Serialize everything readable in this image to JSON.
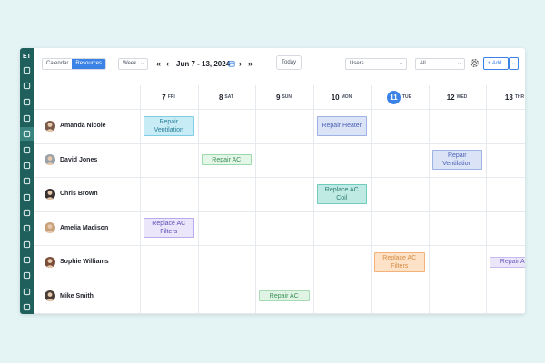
{
  "sidebar": {
    "logo": "ET",
    "icons": [
      "home-icon",
      "tool-icon",
      "plug-icon",
      "users-icon",
      "briefcase-icon",
      "user-icon",
      "folder-icon",
      "dollar-icon",
      "document-icon",
      "gem-icon",
      "team-icon",
      "wrench-icon",
      "chart-icon",
      "inbox-icon",
      "report-icon",
      "logout-icon"
    ]
  },
  "toolbar": {
    "views": [
      "Calendar",
      "Resources"
    ],
    "active_view": "Resources",
    "range_select": "Week",
    "date_range": "Jun 7 - 13, 2024",
    "today_label": "Today",
    "users_select": "Users",
    "filter_select": "All",
    "add_label": "+ Add"
  },
  "days": [
    {
      "num": "7",
      "name": "FRI",
      "today": false
    },
    {
      "num": "8",
      "name": "SAT",
      "today": false
    },
    {
      "num": "9",
      "name": "SUN",
      "today": false
    },
    {
      "num": "10",
      "name": "MON",
      "today": false
    },
    {
      "num": "11",
      "name": "TUE",
      "today": true
    },
    {
      "num": "12",
      "name": "WED",
      "today": false
    },
    {
      "num": "13",
      "name": "THR",
      "today": false
    }
  ],
  "people": [
    {
      "name": "Amanda Nicole"
    },
    {
      "name": "David Jones"
    },
    {
      "name": "Chris Brown"
    },
    {
      "name": "Amelia Madison"
    },
    {
      "name": "Sophie Williams"
    },
    {
      "name": "Mike Smith"
    }
  ],
  "events": [
    {
      "label": "Repair Ventilation",
      "person": 0,
      "day": 0,
      "color": "cyan"
    },
    {
      "label": "Repair Heater",
      "person": 0,
      "day": 3,
      "color": "blue"
    },
    {
      "label": "Repair AC",
      "person": 1,
      "day": 1,
      "color": "green"
    },
    {
      "label": "Repair Ventilation",
      "person": 1,
      "day": 5,
      "color": "blue"
    },
    {
      "label": "Replace AC Coil",
      "person": 2,
      "day": 3,
      "color": "teal"
    },
    {
      "label": "Replace AC Filters",
      "person": 3,
      "day": 0,
      "color": "purple"
    },
    {
      "label": "Replace AC Filters",
      "person": 4,
      "day": 4,
      "color": "orange"
    },
    {
      "label": "Repair AC",
      "person": 4,
      "day": 6,
      "color": "lav"
    },
    {
      "label": "Repair AC",
      "person": 5,
      "day": 2,
      "color": "green2"
    }
  ],
  "colors": {
    "accent": "#3b82e6",
    "sidebar": "#1f5f5c",
    "background": "#e4f4f5"
  }
}
